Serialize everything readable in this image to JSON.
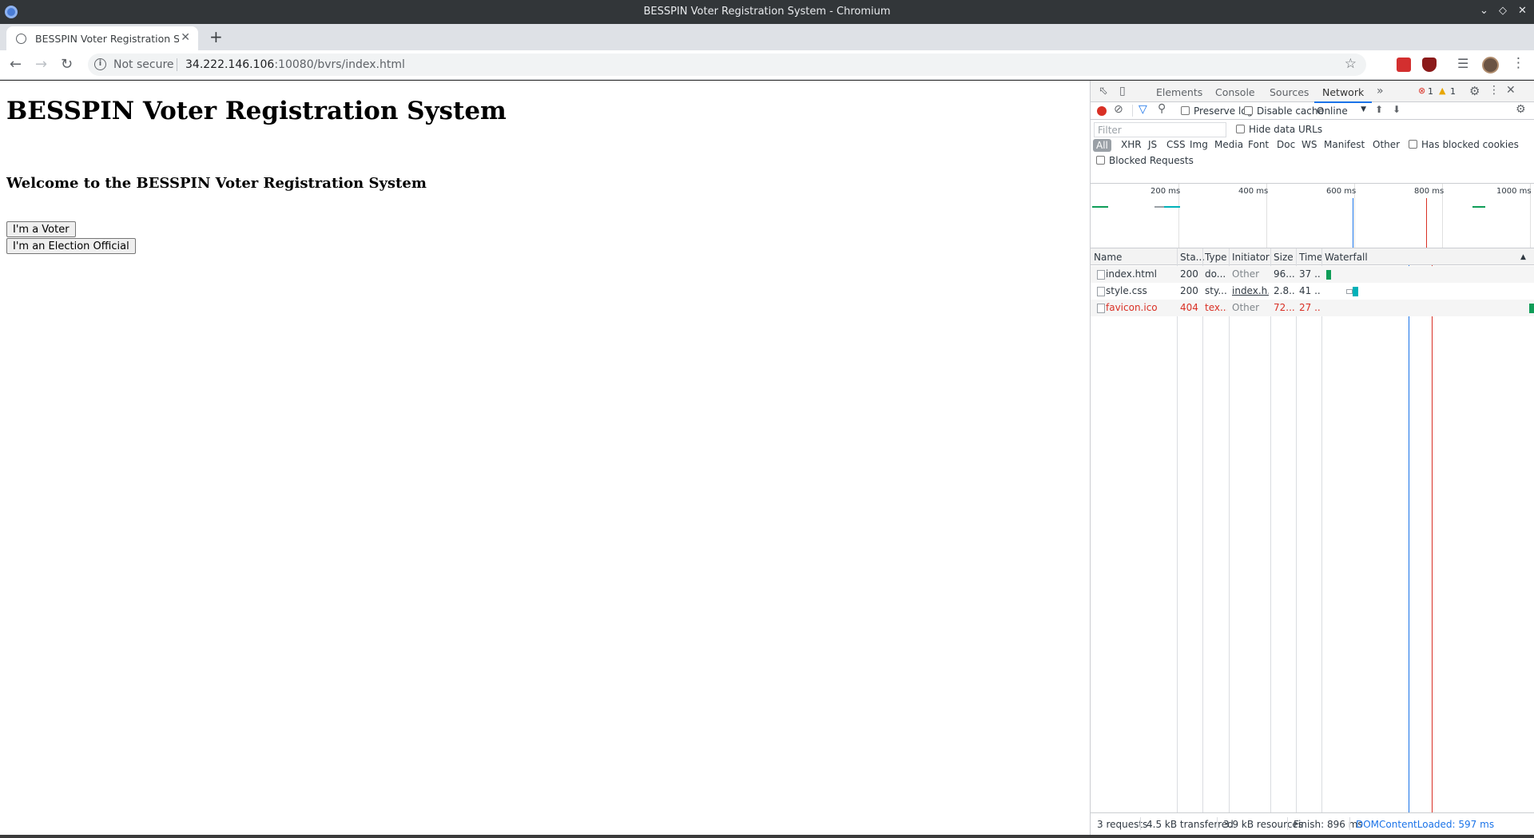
{
  "window": {
    "title": "BESSPIN Voter Registration System - Chromium"
  },
  "tab": {
    "title": "BESSPIN Voter Registration S"
  },
  "omnibox": {
    "security_label": "Not secure",
    "url_host": "34.222.146.106",
    "url_rest": ":10080/bvrs/index.html"
  },
  "page": {
    "heading": "BESSPIN Voter Registration System",
    "welcome": "Welcome to the BESSPIN Voter Registration System",
    "voter_button": "I'm a Voter",
    "official_button": "I'm an Election Official"
  },
  "devtools": {
    "tabs": [
      "Elements",
      "Console",
      "Sources",
      "Network"
    ],
    "active_tab": "Network",
    "error_count": "1",
    "warning_count": "1",
    "toolbar": {
      "preserve_log": "Preserve log",
      "disable_cache": "Disable cache",
      "throttle": "Online"
    },
    "filter": {
      "placeholder": "Filter",
      "hide_data_urls": "Hide data URLs",
      "types": [
        "All",
        "XHR",
        "JS",
        "CSS",
        "Img",
        "Media",
        "Font",
        "Doc",
        "WS",
        "Manifest",
        "Other"
      ],
      "has_blocked_cookies": "Has blocked cookies",
      "blocked_requests": "Blocked Requests"
    },
    "timeline": {
      "labels": [
        "200 ms",
        "400 ms",
        "600 ms",
        "800 ms",
        "1000 ms"
      ]
    },
    "columns": [
      "Name",
      "Sta...",
      "Type",
      "Initiator",
      "Size",
      "Time",
      "Waterfall"
    ],
    "requests": [
      {
        "name": "index.html",
        "status": "200",
        "type": "do...",
        "initiator": "Other",
        "size": "96...",
        "time": "37 ..."
      },
      {
        "name": "style.css",
        "status": "200",
        "type": "sty...",
        "initiator": "index.h...",
        "size": "2.8...",
        "time": "41 ..."
      },
      {
        "name": "favicon.ico",
        "status": "404",
        "type": "tex...",
        "initiator": "Other",
        "size": "72...",
        "time": "27 ..."
      }
    ],
    "status": {
      "requests": "3 requests",
      "transferred": "4.5 kB transferred",
      "resources": "3.9 kB resources",
      "finish": "Finish: 896 ms",
      "dom_content_loaded": "DOMContentLoaded: 597 ms"
    }
  },
  "colors": {
    "record": "#d93025",
    "accent": "#1a73e8",
    "waterfall_bar": "#00b1b8",
    "error_text": "#d93025"
  }
}
